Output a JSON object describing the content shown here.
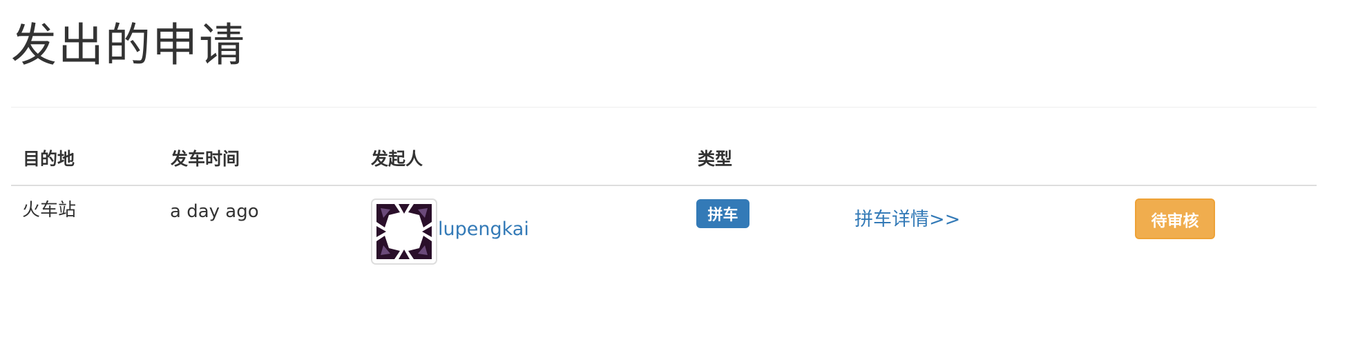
{
  "page": {
    "title": "发出的申请"
  },
  "table": {
    "headers": {
      "destination": "目的地",
      "departure_time": "发车时间",
      "initiator": "发起人",
      "type": "类型"
    },
    "rows": [
      {
        "destination": "火车站",
        "departure_time": "a day ago",
        "initiator": "lupengkai",
        "type_badge": "拼车",
        "detail_link": "拼车详情>>",
        "status_button": "待审核"
      }
    ]
  },
  "colors": {
    "link": "#337ab7",
    "badge_primary": "#337ab7",
    "status_warning": "#f0ad4e"
  },
  "icons": {
    "avatar": "generated-identicon-avatar"
  }
}
